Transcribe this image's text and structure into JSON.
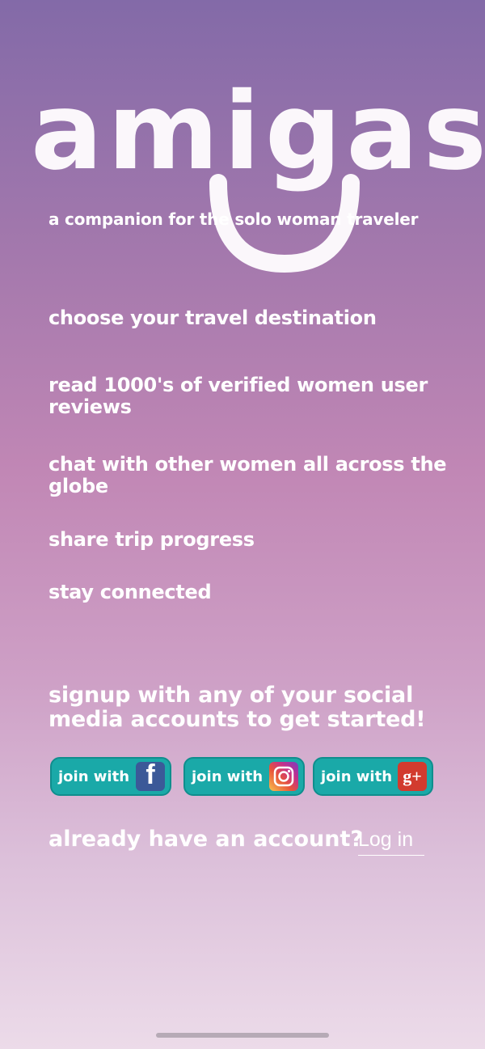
{
  "app": {
    "logo_text": "amigas",
    "tagline": "a companion for the solo woman traveler"
  },
  "features": [
    {
      "label": "choose your travel destination"
    },
    {
      "label": "read 1000's of verified women user reviews"
    },
    {
      "label": "chat with other women all across the globe"
    },
    {
      "label": "share trip progress"
    },
    {
      "label": "stay connected"
    }
  ],
  "signup": {
    "prompt": "signup with any of your social media accounts to get started!",
    "buttons": [
      {
        "label": "join with",
        "icon": "facebook-icon",
        "color": "#1aa9a8"
      },
      {
        "label": "join with",
        "icon": "instagram-icon",
        "color": "#1aa9a8"
      },
      {
        "label": "join with",
        "icon": "google-plus-icon",
        "color": "#1aa9a8"
      }
    ]
  },
  "login": {
    "prompt": "already have an account?",
    "link_label": "Log in"
  },
  "icons": {
    "facebook_glyph": "f",
    "google_plus_glyph": "g+"
  }
}
